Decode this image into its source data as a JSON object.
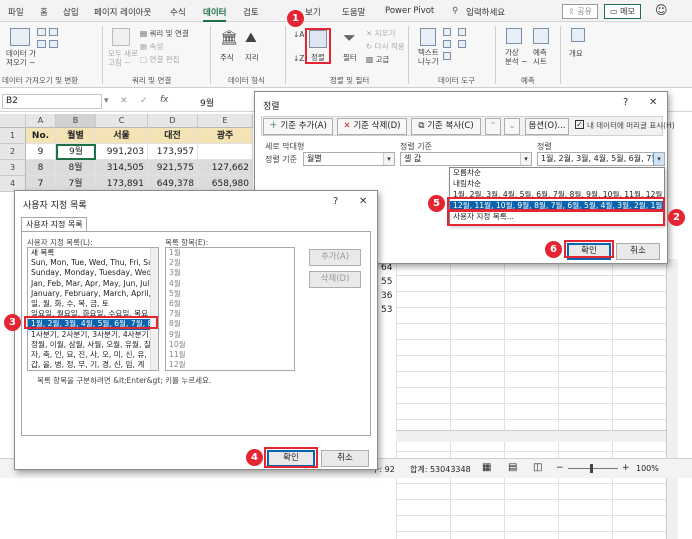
{
  "ribbon": {
    "tabs": [
      "파일",
      "홈",
      "삽입",
      "페이지 레이아웃",
      "수식",
      "데이터",
      "검토",
      "보기",
      "도움말",
      "Power Pivot"
    ],
    "active_tab": "데이터",
    "search_placeholder": "입력하세요",
    "share_label": "공유",
    "memo_label": "메모",
    "groups": {
      "get_data": "데이터 가져오기 및 변환",
      "query": "쿼리 및 연결",
      "data_types": "데이터 형식",
      "sort_filter": "정렬 및 필터",
      "data_tools": "데이터 도구",
      "forecast": "예측"
    },
    "items": {
      "get_data_btn": "데이터 가\n져오기 ~",
      "refresh_all": "모두 새로\n고침 ~",
      "query_conn": "쿼리 및 연결",
      "properties": "속성",
      "edit_links": "연결 편집",
      "stocks": "주식",
      "geography": "지리",
      "sort": "정렬",
      "filter": "필터",
      "clear": "지우기",
      "reapply": "다시 적용",
      "advanced": "고급",
      "text_to_columns": "텍스트\n나누기",
      "what_if": "가상\n분석 ~",
      "forecast_sheet": "예측\n시트",
      "outline": "개요"
    }
  },
  "formula_bar": {
    "name_box": "B2",
    "formula": "9월"
  },
  "sheet": {
    "columns": [
      "A",
      "B",
      "C",
      "D",
      "E"
    ],
    "rows": [
      [
        "1",
        "No.",
        "월별",
        "서울",
        "대전",
        "광주"
      ],
      [
        "2",
        "9",
        "9월",
        "991,203",
        "173,957",
        ""
      ],
      [
        "3",
        "8",
        "8월",
        "314,505",
        "921,575",
        "127,662"
      ],
      [
        "4",
        "7",
        "7월",
        "173,891",
        "649,378",
        "658,980"
      ]
    ],
    "partial_values": [
      "64",
      "55",
      "36",
      "53"
    ]
  },
  "sort_dialog": {
    "title": "정렬",
    "add_level": "기준 추가(A)",
    "delete_level": "기준 삭제(D)",
    "copy_level": "기준 복사(C)",
    "options": "옵션(O)...",
    "header_checkbox": "내 데이터에 머리글 표시(H)",
    "col_headers": [
      "세로 막대형",
      "정렬 기준",
      "정렬"
    ],
    "row_label": "정렬 기준",
    "column_value": "월별",
    "sort_on_value": "셀 값",
    "order_value": "1월, 2월, 3월, 4월, 5월, 6월, 7월",
    "order_options": [
      "오름차순",
      "내림차순",
      "1월, 2월, 3월, 4월, 5월, 6월, 7월, 8월, 9월, 10월, 11월, 12월",
      "12월, 11월, 10월, 9월, 8월, 7월, 6월, 5월, 4월, 3월, 2월, 1월",
      "사용자 지정 목록..."
    ],
    "ok": "확인",
    "cancel": "취소"
  },
  "custom_dialog": {
    "title": "사용자 지정 목록",
    "tab": "사용자 지정 목록",
    "lists_label": "사용자 지정 목록(L):",
    "entries_label": "목록 항목(E):",
    "lists": [
      "새 목록",
      "Sun, Mon, Tue, Wed, Thu, Fri, Sat",
      "Sunday, Monday, Tuesday, Wednes",
      "Jan, Feb, Mar, Apr, May, Jun, Jul, A",
      "January, February, March, April, Ma",
      "일, 월, 화, 수, 목, 금, 토",
      "일요일, 월요일, 화요일, 수요일, 목요",
      "1월, 2월, 3월, 4월, 5월, 6월, 7월, 8월",
      "1사분기, 2사분기, 3사분기, 4사분기",
      "정월, 이월, 삼월, 사월, 오월, 유월, 칠",
      "자, 축, 인, 묘, 진, 사, 오, 미, 신, 유,",
      "갑, 을, 병, 정, 무, 기, 경, 신, 임, 계"
    ],
    "entries": [
      "1월",
      "2월",
      "3월",
      "4월",
      "5월",
      "6월",
      "7월",
      "8월",
      "9월",
      "10월",
      "11월",
      "12월"
    ],
    "add_btn": "추가(A)",
    "delete_btn": "삭제(D)",
    "hint": "목록 항목을 구분하려면 &lt;Enter&gt; 키를 누르세요.",
    "ok": "확인",
    "cancel": "취소"
  },
  "status_bar": {
    "count": "수: 92",
    "sum": "합계: 53043348",
    "zoom": "100%"
  },
  "callouts": [
    "1",
    "2",
    "3",
    "4",
    "5",
    "6"
  ],
  "colors": {
    "accent": "#1e7145",
    "callout": "#e52532",
    "selection": "#0a64ad",
    "header_fill": "#f4e3b5"
  }
}
